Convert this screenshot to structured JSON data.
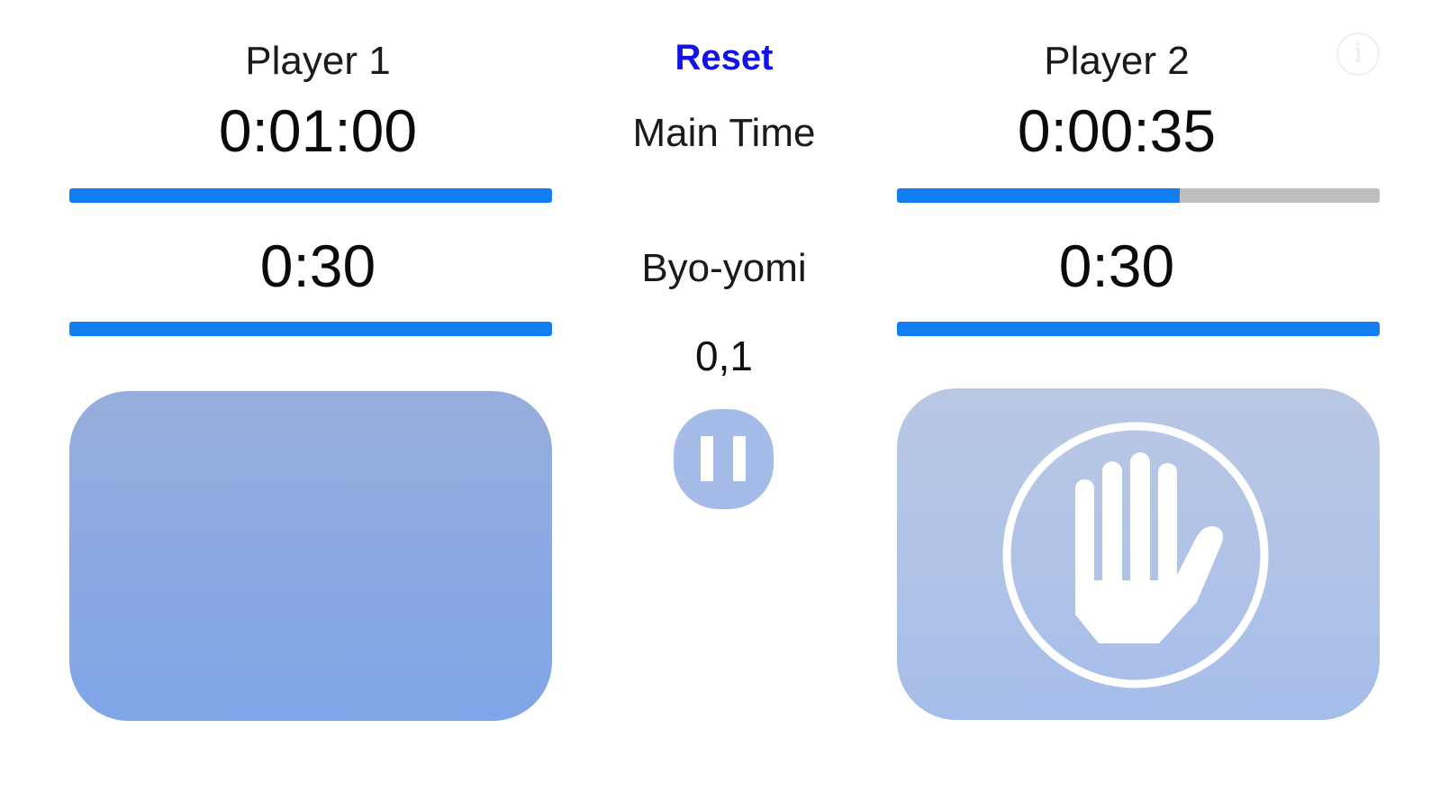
{
  "header": {
    "player1_label": "Player 1",
    "player2_label": "Player 2",
    "reset_label": "Reset",
    "info_icon": "info-icon",
    "info_glyph": "i"
  },
  "labels": {
    "main_time": "Main Time",
    "byo_yomi": "Byo-yomi",
    "periods": "0,1"
  },
  "player1": {
    "main_time": "0:01:00",
    "main_progress": 1.0,
    "byo_time": "0:30",
    "byo_progress": 1.0
  },
  "player2": {
    "main_time": "0:00:35",
    "main_progress": 0.585,
    "byo_time": "0:30",
    "byo_progress": 1.0
  },
  "icons": {
    "pause": "pause-icon",
    "hand": "stop-hand-icon"
  },
  "colors": {
    "progress_fill": "#137ef1",
    "progress_track": "#bdbdbd",
    "reset": "#1414e6",
    "pad_active": "#8aa9e2",
    "pad_inactive": "#b0c3e7"
  }
}
